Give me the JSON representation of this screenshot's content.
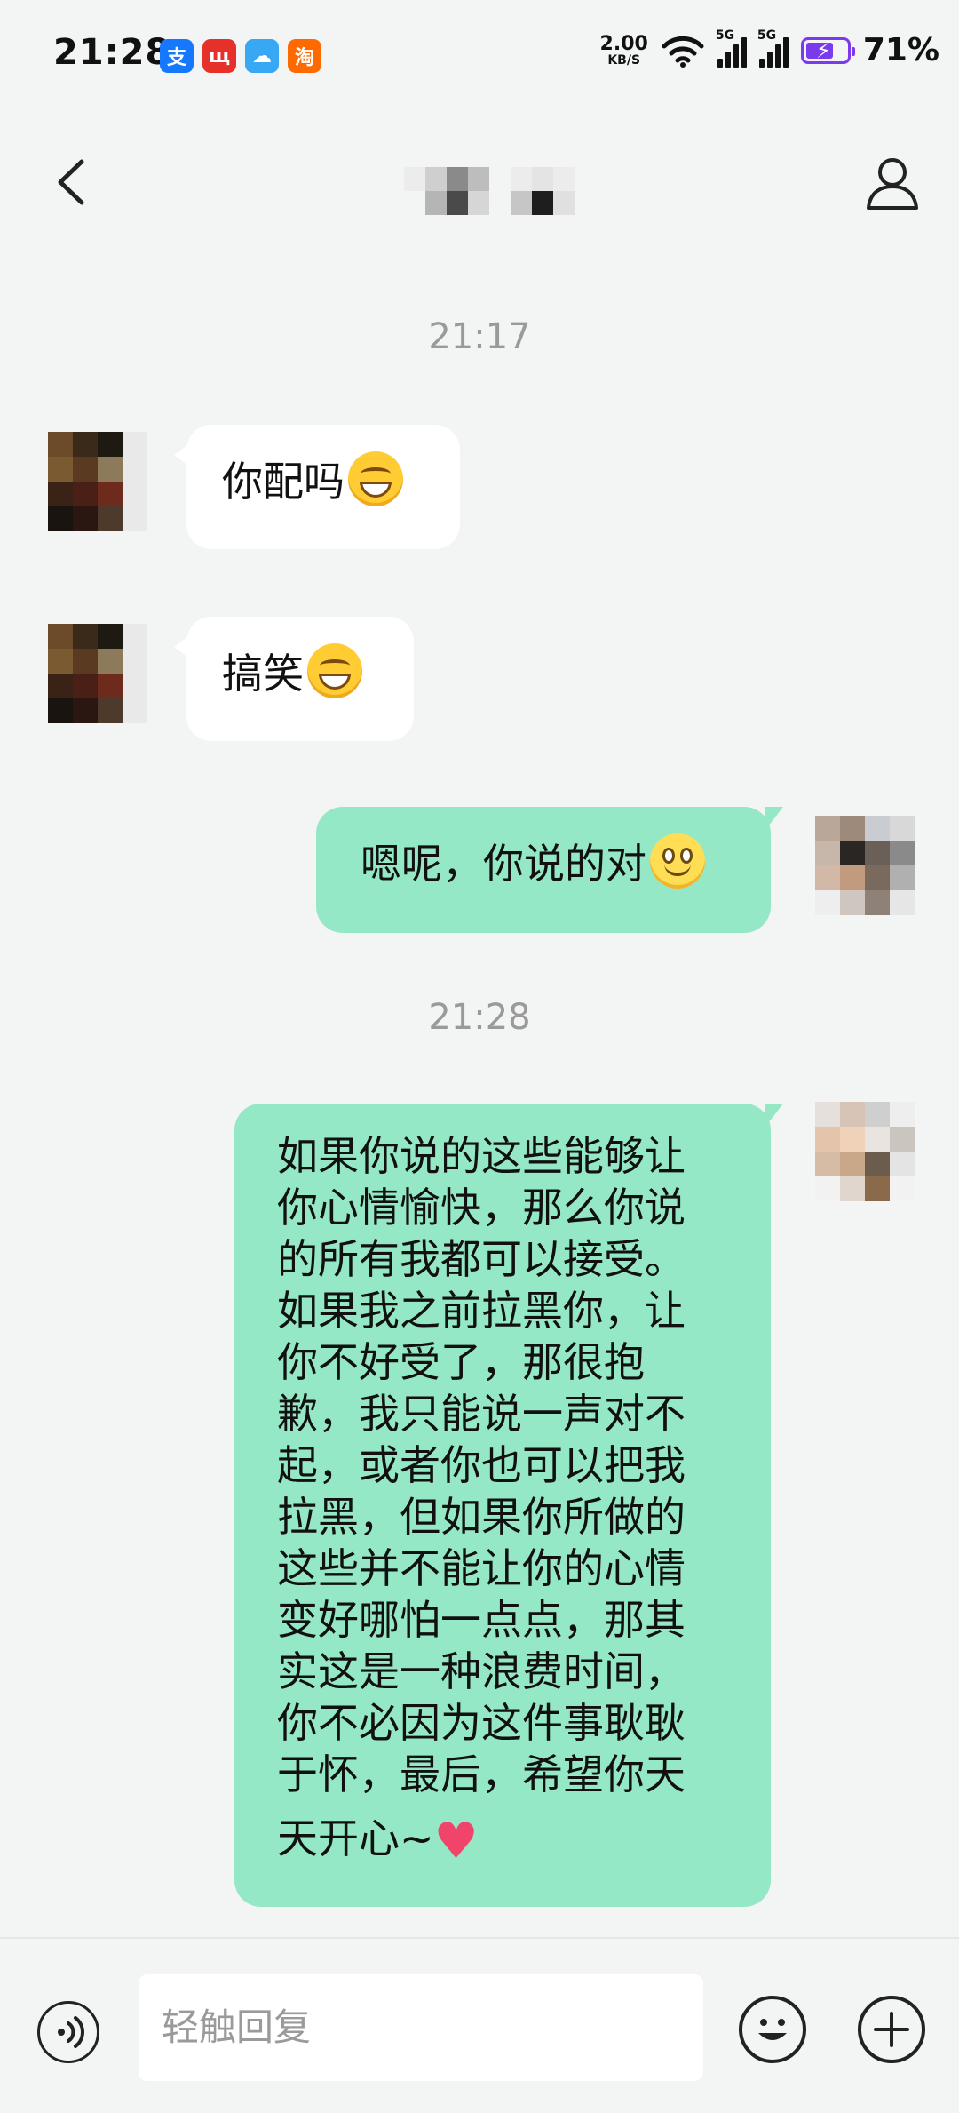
{
  "status_bar": {
    "time": "21:28",
    "app_icons": [
      {
        "name": "alipay-icon",
        "glyph": "支",
        "color": "#1677ff"
      },
      {
        "name": "news-app-icon",
        "glyph": "щ",
        "color": "#e5312a"
      },
      {
        "name": "weather-icon",
        "glyph": "☁",
        "color": "#38a8f5"
      },
      {
        "name": "taobao-flash-icon",
        "glyph": "淘",
        "color": "#ff6a00"
      }
    ],
    "net_speed_value": "2.00",
    "net_speed_unit": "KB/S",
    "signal_label_1": "5G",
    "signal_label_2": "5G",
    "battery": "71%"
  },
  "header": {
    "back_icon": "chevron-left-icon",
    "profile_icon": "person-icon"
  },
  "messages": [
    {
      "type": "timestamp",
      "text": "21:17"
    },
    {
      "type": "incoming",
      "text": "你配吗",
      "emoji": "grin-emoji"
    },
    {
      "type": "incoming",
      "text": "搞笑",
      "emoji": "grin-emoji"
    },
    {
      "type": "outgoing",
      "text": "嗯呢，你说的对",
      "emoji": "smile-emoji"
    },
    {
      "type": "timestamp",
      "text": "21:28"
    },
    {
      "type": "outgoing",
      "lines": [
        "如果你说的这些能够让",
        "你心情愉快，那么你说",
        "的所有我都可以接受。",
        "如果我之前拉黑你，让",
        "你不好受了，那很抱",
        "歉，我只能说一声对不",
        "起，或者你也可以把我",
        "拉黑，但如果你所做的",
        "这些并不能让你的心情",
        "变好哪怕一点点，那其",
        "实这是一种浪费时间，",
        "你不必因为这件事耿耿",
        "于怀，最后，希望你天",
        "天开心~"
      ],
      "emoji": "heart-emoji"
    }
  ],
  "input_bar": {
    "placeholder": "轻触回复",
    "voice_icon": "voice-icon",
    "emoji_icon": "emoji-icon",
    "plus_icon": "plus-icon"
  }
}
